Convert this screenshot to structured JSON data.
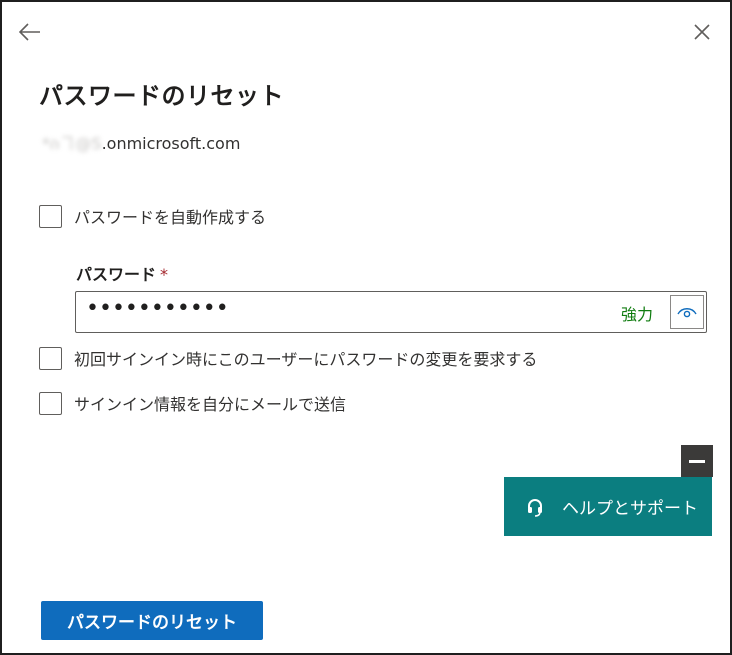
{
  "panel": {
    "title": "パスワードのリセット",
    "user_email_prefix": "*ስヿ@S",
    "user_email_suffix": ".onmicrosoft.com"
  },
  "autogen": {
    "label": "パスワードを自動作成する",
    "checked": false
  },
  "password": {
    "label": "パスワード",
    "required_marker": "*",
    "masked_value": "•••••••••••",
    "strength": "強力"
  },
  "require_change": {
    "label": "初回サインイン時にこのユーザーにパスワードの変更を要求する",
    "checked": false
  },
  "send_to_me": {
    "label": "サインイン情報を自分にメールで送信",
    "checked": false
  },
  "help": {
    "label": "ヘルプとサポート"
  },
  "actions": {
    "reset_label": "パスワードのリセット"
  },
  "icons": {
    "back": "arrow-left-icon",
    "close": "close-icon",
    "reveal": "eye-icon",
    "help": "headset-icon",
    "minimize": "minimize-icon"
  },
  "colors": {
    "primary": "#0f6cbd",
    "help_bg": "#0b7e80",
    "strength": "#107c10",
    "required": "#a4262c"
  }
}
